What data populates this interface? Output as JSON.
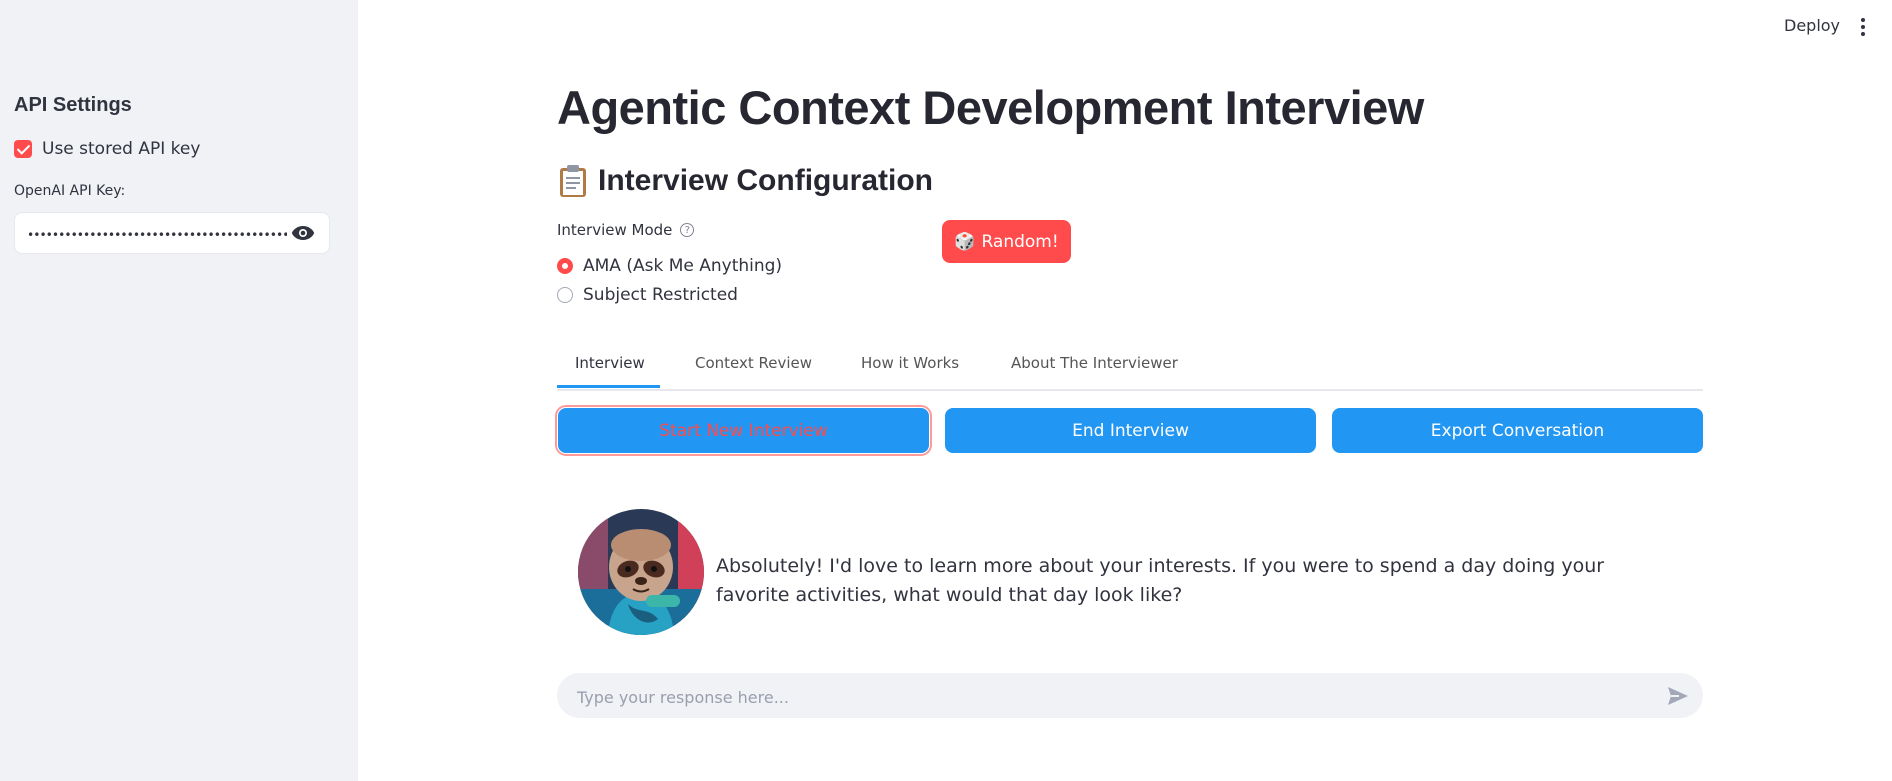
{
  "sidebar": {
    "title": "API Settings",
    "checkbox_label": "Use stored API key",
    "checkbox_checked": true,
    "api_key_label": "OpenAI API Key:",
    "api_key_value": "••••••••••••••••••••••••••••••••••••••••••••••••••"
  },
  "header": {
    "deploy_label": "Deploy"
  },
  "main": {
    "title": "Agentic Context Development Interview",
    "section_title": "Interview Configuration",
    "mode_label": "Interview Mode",
    "help_glyph": "?",
    "radio_options": [
      {
        "label": "AMA (Ask Me Anything)",
        "selected": true
      },
      {
        "label": "Subject Restricted",
        "selected": false
      }
    ],
    "random_button": "Random!",
    "random_icon": "🎲",
    "tabs": [
      {
        "label": "Interview",
        "active": true
      },
      {
        "label": "Context Review",
        "active": false
      },
      {
        "label": "How it Works",
        "active": false
      },
      {
        "label": "About The Interviewer",
        "active": false
      }
    ],
    "buttons": {
      "start": "Start New Interview",
      "end": "End Interview",
      "export": "Export Conversation"
    },
    "message": "Absolutely! I'd love to learn more about your interests. If you were to spend a day doing your favorite activities, what would that day look like?",
    "chat_placeholder": "Type your response here..."
  },
  "colors": {
    "accent_red": "#ff4b4b",
    "primary_blue": "#2196f3",
    "sidebar_bg": "#f0f2f6"
  }
}
